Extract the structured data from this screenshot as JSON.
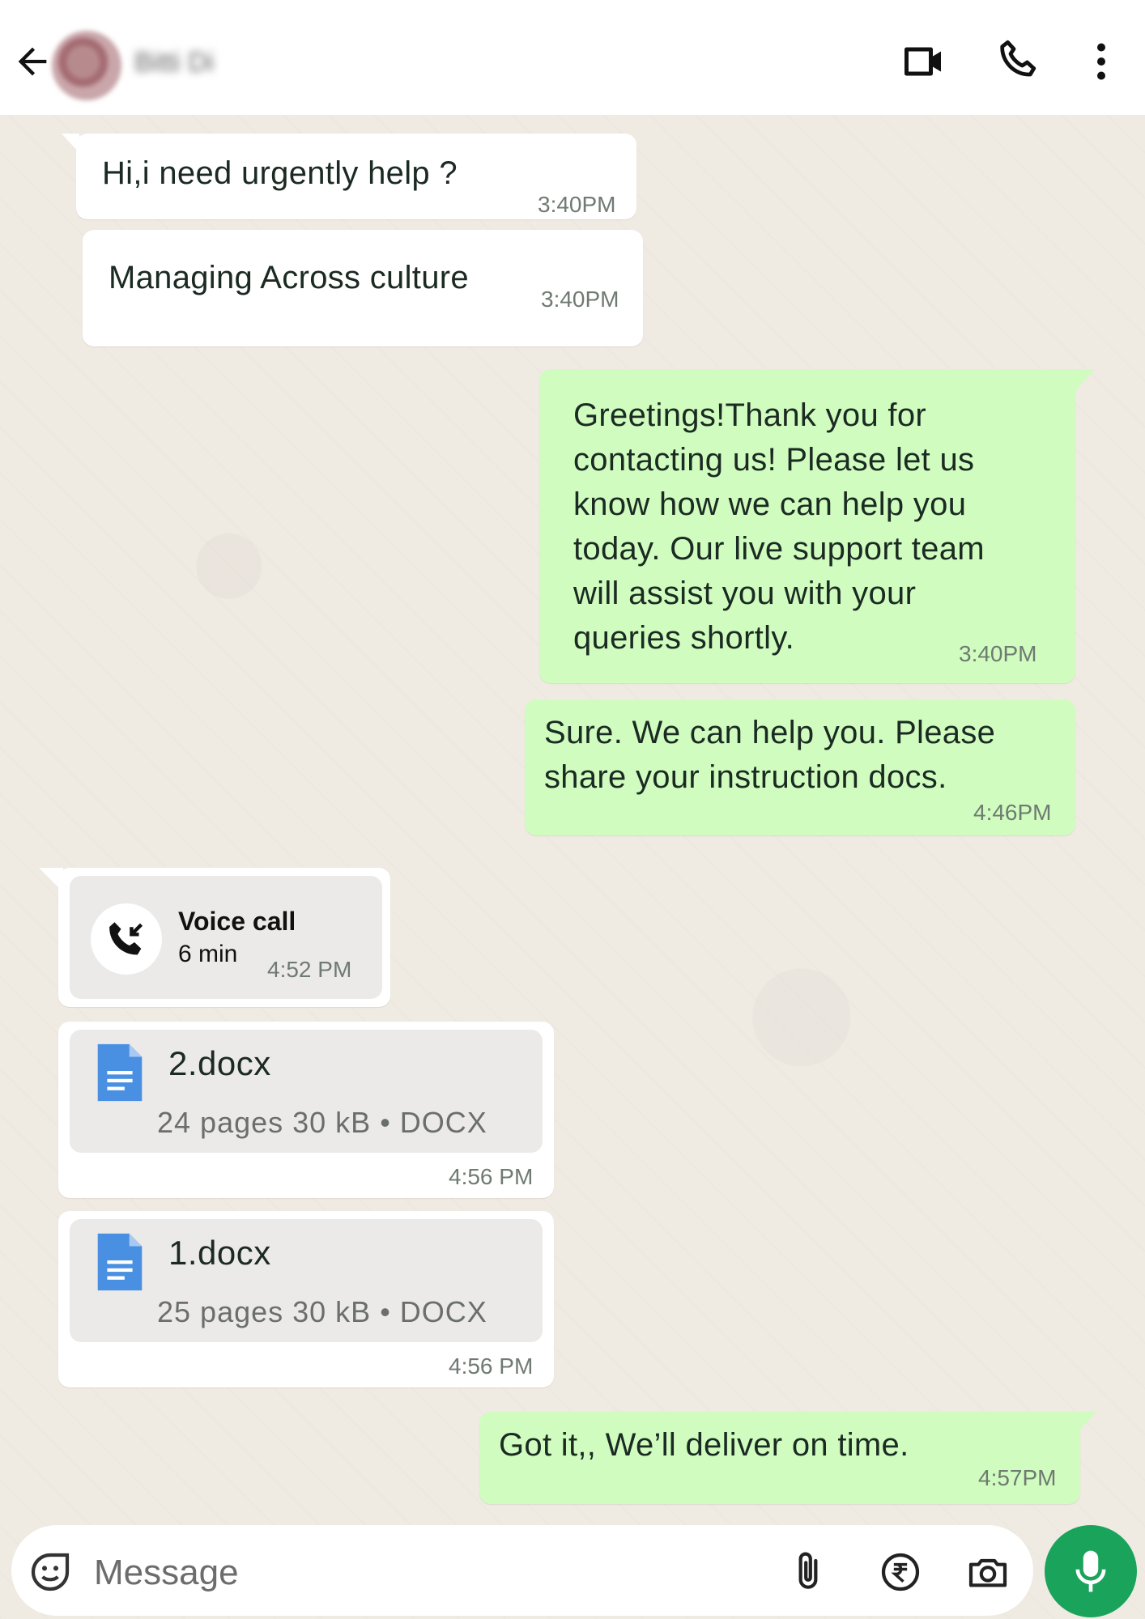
{
  "header": {
    "contact_name": "Bitti Di"
  },
  "messages": [
    {
      "direction": "incoming",
      "text": "Hi,i need urgently help ?",
      "time": "3:40PM"
    },
    {
      "direction": "incoming",
      "text": "Managing Across culture",
      "time": "3:40PM"
    },
    {
      "direction": "outgoing",
      "lines": [
        "Greetings!Thank you for",
        "contacting us! Please let us",
        "know how we can help you",
        "today. Our live support team",
        "will assist you with your",
        "queries shortly."
      ],
      "time": "3:40PM"
    },
    {
      "direction": "outgoing",
      "lines": [
        "Sure. We can help you. Please",
        "share your instruction docs."
      ],
      "time": "4:46PM"
    },
    {
      "direction": "incoming",
      "type": "call",
      "title": "Voice call",
      "duration": "6 min",
      "time": "4:52 PM"
    },
    {
      "direction": "incoming",
      "type": "document",
      "filename": "2.docx",
      "meta": "24 pages 30 kB • DOCX",
      "time": "4:56 PM"
    },
    {
      "direction": "incoming",
      "type": "document",
      "filename": "1.docx",
      "meta": "25 pages 30 kB • DOCX",
      "time": "4:56 PM"
    },
    {
      "direction": "outgoing",
      "text": "Got it,, We’ll deliver on time.",
      "time": "4:57PM"
    }
  ],
  "composer": {
    "placeholder": "Message"
  },
  "icons": {
    "back": "arrow-left-icon",
    "video": "video-camera-icon",
    "call": "phone-icon",
    "menu": "more-vertical-icon",
    "emoji": "sticker-icon",
    "attach": "paperclip-icon",
    "payment": "rupee-icon",
    "camera": "camera-icon",
    "mic": "microphone-icon"
  },
  "colors": {
    "outgoing_bubble": "#d0fdbf",
    "incoming_bubble": "#ffffff",
    "accent": "#1aa35b",
    "doc_blue": "#4a90e2"
  }
}
